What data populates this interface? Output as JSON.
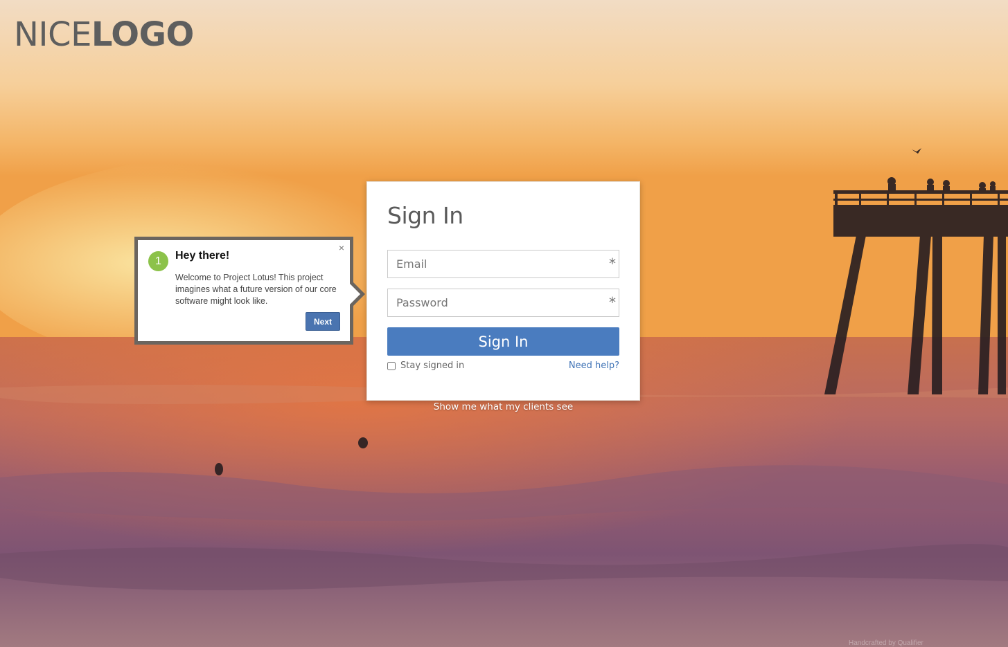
{
  "brand": {
    "logo_light": "NICE",
    "logo_bold": "LOGO"
  },
  "tour_tip": {
    "step_number": "1",
    "title": "Hey there!",
    "body": "Welcome to Project Lotus! This project imagines what a future version of our core software might look like.",
    "next_label": "Next",
    "close_icon": "×"
  },
  "login": {
    "heading": "Sign In",
    "email_placeholder": "Email",
    "password_placeholder": "Password",
    "required_marker": "*",
    "submit_label": "Sign In",
    "remember_label": "Stay signed in",
    "help_link": "Need help?",
    "clients_link": "Show me what my clients see"
  },
  "background": {
    "description_icon": "sunset-pier-photo",
    "credit": "Handcrafted by Qualifier"
  },
  "colors": {
    "primary": "#4a7cbf",
    "step_badge": "#8cc24a",
    "tip_border": "#6b655f"
  }
}
